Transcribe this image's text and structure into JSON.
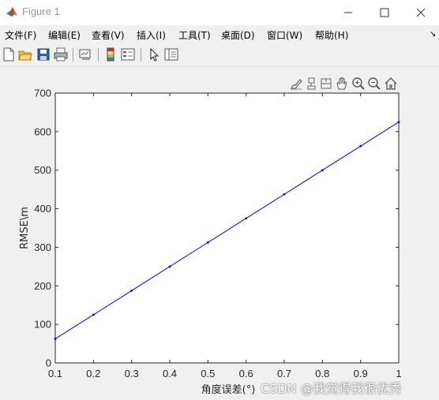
{
  "window": {
    "title": "Figure 1"
  },
  "menu": [
    {
      "label": "文件(F)"
    },
    {
      "label": "编辑(E)"
    },
    {
      "label": "查看(V)"
    },
    {
      "label": "插入(I)"
    },
    {
      "label": "工具(T)"
    },
    {
      "label": "桌面(D)"
    },
    {
      "label": "窗口(W)"
    },
    {
      "label": "帮助(H)"
    }
  ],
  "toolbar": {
    "icons": [
      "new-figure-icon",
      "open-file-icon",
      "save-icon",
      "print-icon",
      "link-plot-icon",
      "insert-colorbar-icon",
      "insert-legend-icon",
      "edit-plot-arrow-icon",
      "property-inspector-icon"
    ]
  },
  "axes_toolbar": {
    "icons": [
      "brush-icon",
      "data-tips-icon",
      "pan-icon",
      "zoom-in-icon",
      "zoom-out-icon",
      "home-icon"
    ]
  },
  "chart_data": {
    "type": "line",
    "x": [
      0.1,
      0.2,
      0.3,
      0.4,
      0.5,
      0.6,
      0.7,
      0.8,
      0.9,
      1.0
    ],
    "series": [
      {
        "values": [
          62.5,
          125,
          187.5,
          250,
          312.5,
          375,
          437.5,
          500,
          562.5,
          625
        ],
        "color": "#0000ff",
        "marker": "dot"
      }
    ],
    "title": "",
    "xlabel": "角度误差(°)",
    "ylabel": "RMSE\\m",
    "xlim": [
      0.1,
      1
    ],
    "ylim": [
      0,
      700
    ],
    "xticks": [
      "0.1",
      "0.2",
      "0.3",
      "0.4",
      "0.5",
      "0.6",
      "0.7",
      "0.8",
      "0.9",
      "1"
    ],
    "yticks": [
      "0",
      "100",
      "200",
      "300",
      "400",
      "500",
      "600",
      "700"
    ],
    "grid": false
  },
  "watermark": "CSDN @我觉得我很优秀"
}
